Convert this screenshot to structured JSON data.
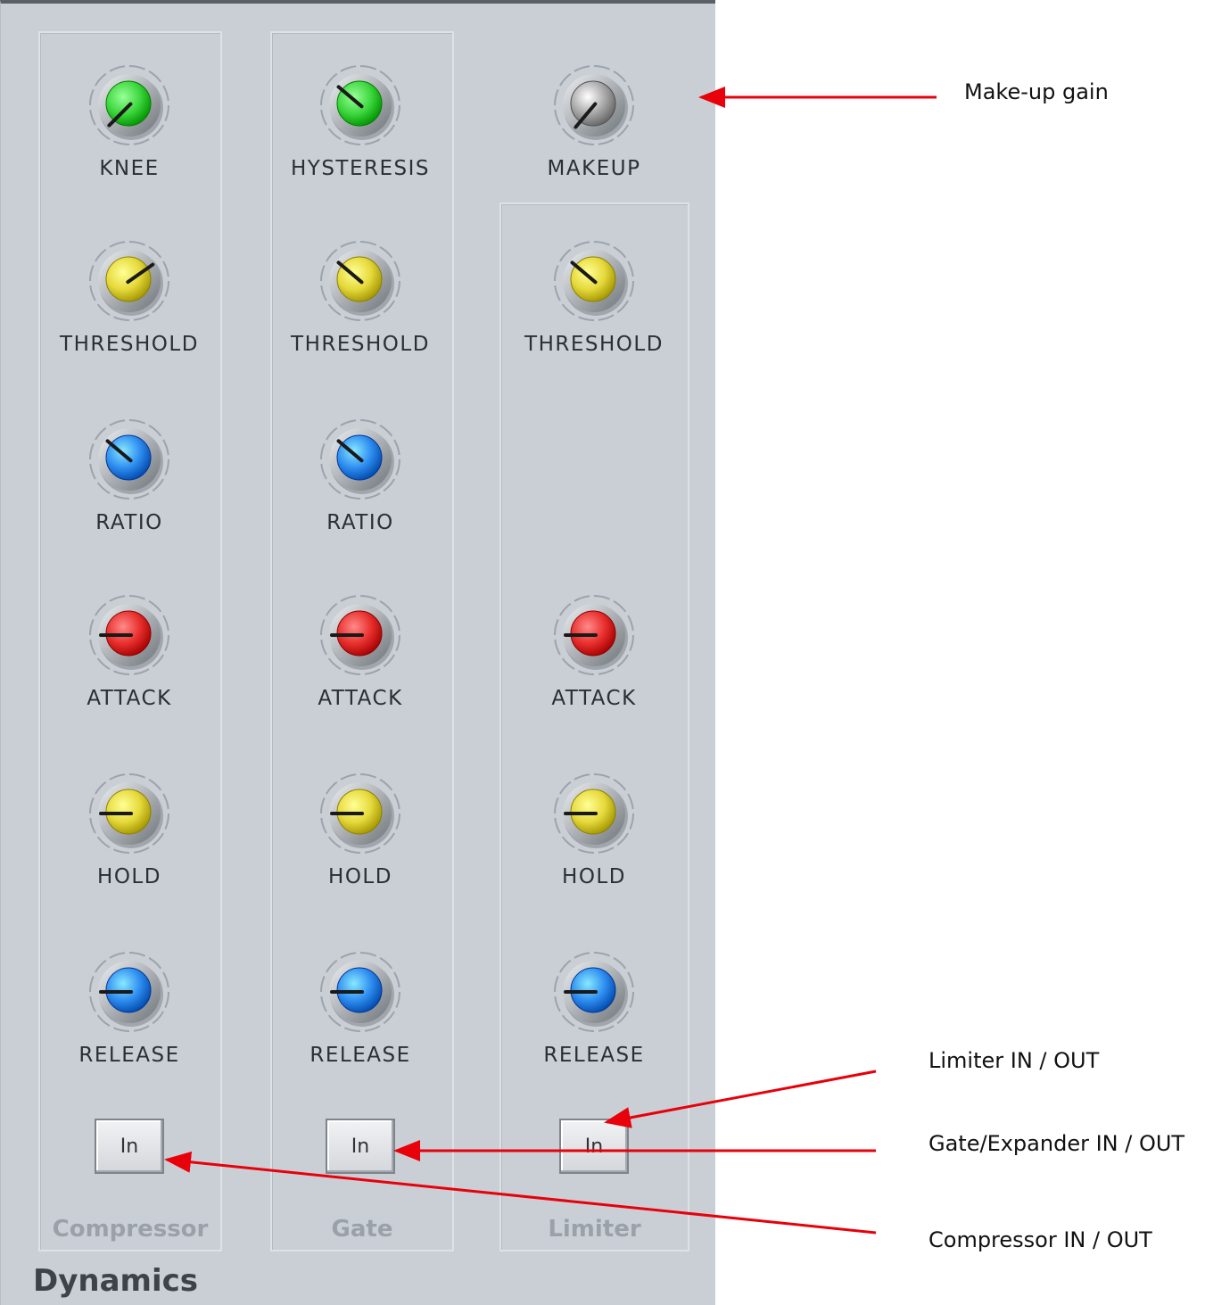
{
  "panel": {
    "title": "Dynamics"
  },
  "colors": {
    "panel_bg": "#c9cfd5",
    "annotation_arrow": "#e8000a",
    "knob_green": "#3ed73e",
    "knob_yellow": "#e6d93b",
    "knob_blue": "#2f8ef0",
    "knob_red": "#e8302e",
    "knob_gray": "#a9a9a9"
  },
  "groups": [
    {
      "name": "Compressor",
      "button_label": "In",
      "knobs": [
        {
          "label": "KNEE",
          "color": "green"
        },
        {
          "label": "THRESHOLD",
          "color": "yellow"
        },
        {
          "label": "RATIO",
          "color": "blue"
        },
        {
          "label": "ATTACK",
          "color": "red"
        },
        {
          "label": "HOLD",
          "color": "yellow"
        },
        {
          "label": "RELEASE",
          "color": "blue"
        }
      ]
    },
    {
      "name": "Gate",
      "button_label": "In",
      "knobs": [
        {
          "label": "HYSTERESIS",
          "color": "green"
        },
        {
          "label": "THRESHOLD",
          "color": "yellow"
        },
        {
          "label": "RATIO",
          "color": "blue"
        },
        {
          "label": "ATTACK",
          "color": "red"
        },
        {
          "label": "HOLD",
          "color": "yellow"
        },
        {
          "label": "RELEASE",
          "color": "blue"
        }
      ]
    },
    {
      "name": "Limiter",
      "button_label": "In",
      "knobs": [
        {
          "label": "THRESHOLD",
          "color": "yellow"
        },
        {
          "label": "ATTACK",
          "color": "red"
        },
        {
          "label": "HOLD",
          "color": "yellow"
        },
        {
          "label": "RELEASE",
          "color": "blue"
        }
      ]
    }
  ],
  "makeup": {
    "label": "MAKEUP",
    "color": "gray"
  },
  "annotations": {
    "makeup": "Make-up gain",
    "limiter": "Limiter IN / OUT",
    "gate": "Gate/Expander IN / OUT",
    "compressor": "Compressor IN / OUT"
  }
}
